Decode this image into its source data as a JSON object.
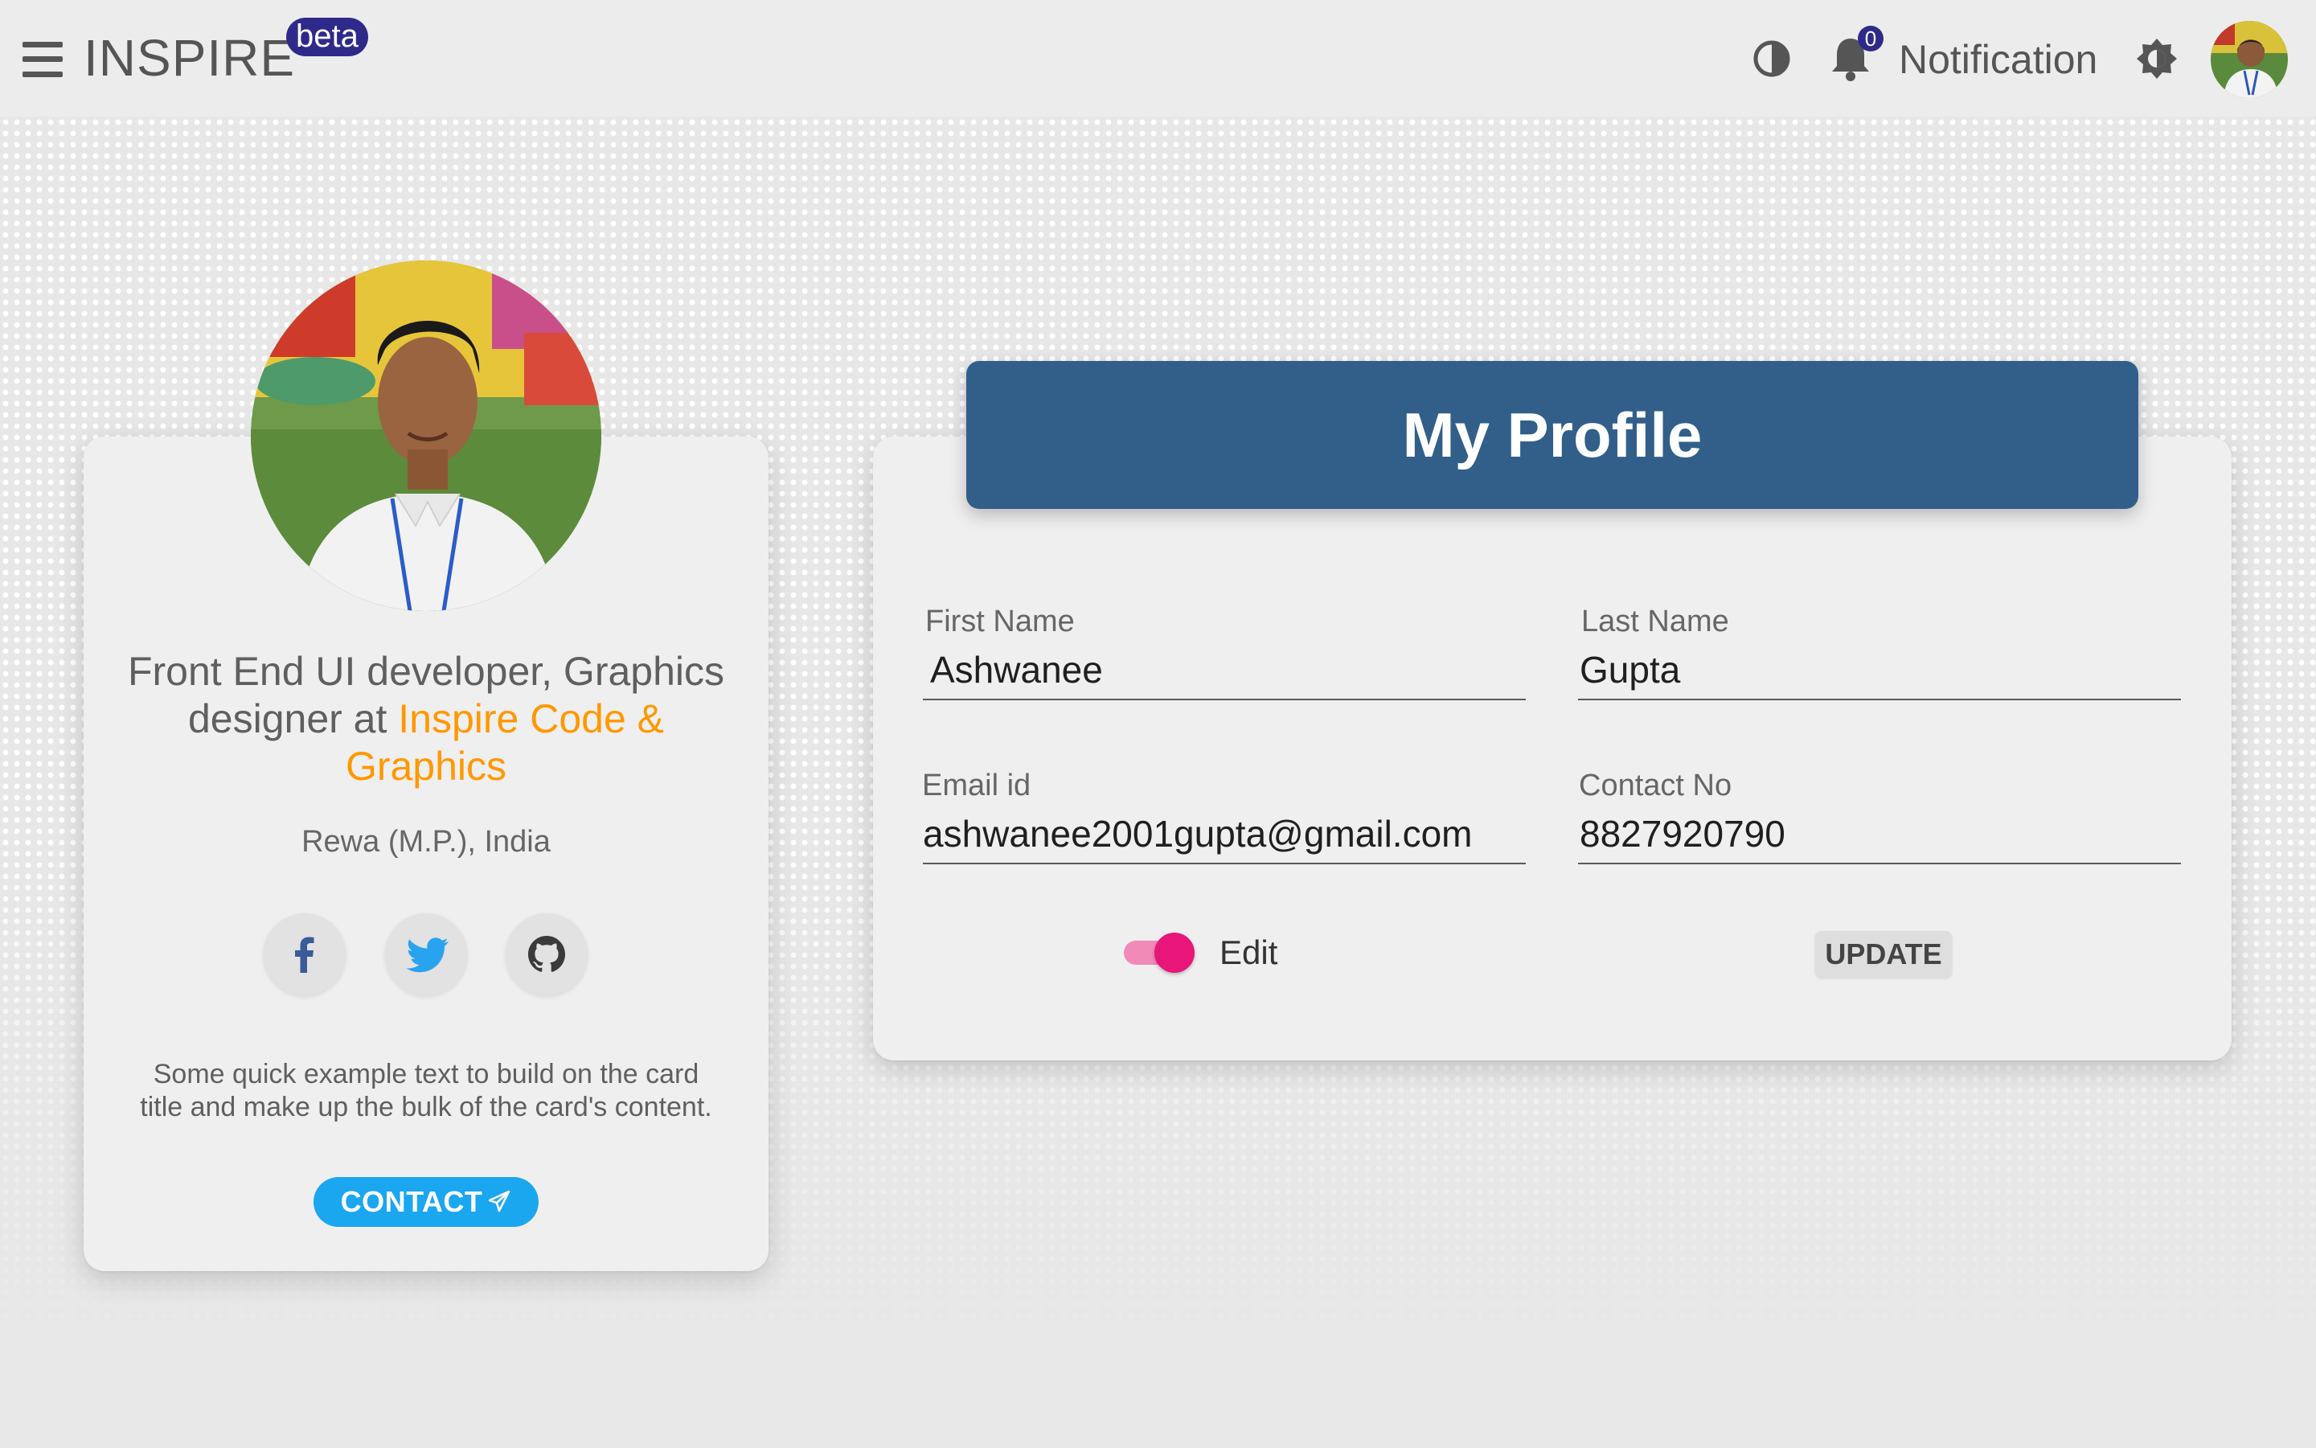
{
  "header": {
    "brand": "INSPIRE",
    "badge": "beta",
    "notification_count": "0",
    "notification_label": "Notification",
    "badge_color": "#2f2a8a"
  },
  "profile_card": {
    "bio_prefix": "Front End UI developer, Graphics designer at ",
    "bio_highlight": "Inspire Code & Graphics",
    "highlight_color": "#ff9800",
    "location": "Rewa (M.P.), India",
    "social_icons": [
      "facebook-icon",
      "twitter-icon",
      "github-icon"
    ],
    "description": "Some quick example text to build on the card title and make up the bulk of the card's content.",
    "contact_button": "CONTACT",
    "contact_button_color": "#1ba6f0"
  },
  "form": {
    "title": "My Profile",
    "title_bg": "#315f8a",
    "first_name_label": "First Name",
    "first_name_value": "Ashwanee",
    "last_name_label": "Last Name",
    "last_name_value": "Gupta",
    "email_label": "Email id",
    "email_value": "ashwanee2001gupta@gmail.com",
    "contact_label": "Contact No",
    "contact_value": "8827920790",
    "edit_label": "Edit",
    "edit_enabled": true,
    "toggle_color": "#e8157a",
    "update_button": "UPDATE"
  }
}
